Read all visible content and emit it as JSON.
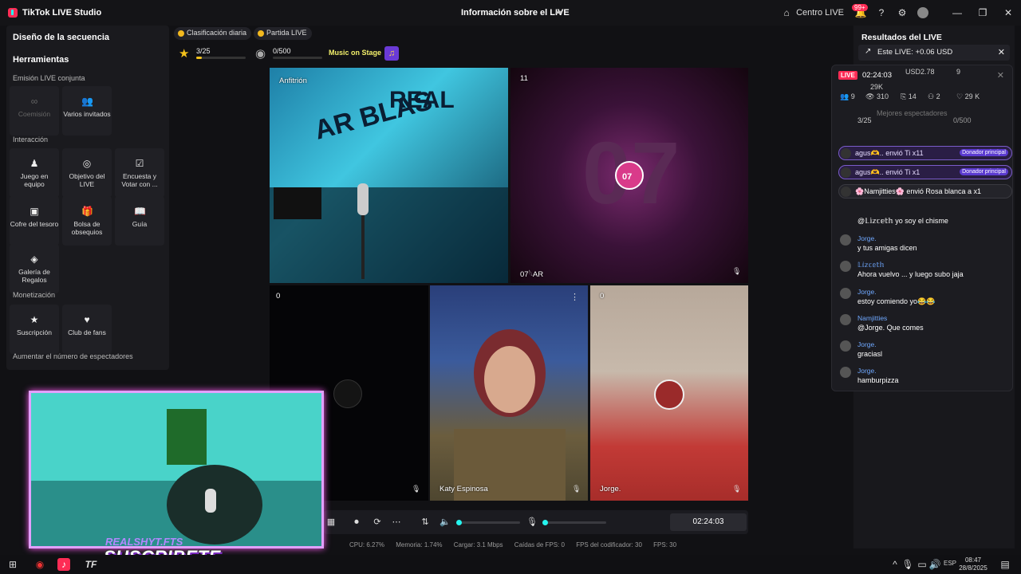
{
  "titlebar": {
    "app_title": "TikTok LIVE Studio",
    "center_title": "Información sobre el LIVE",
    "centro_live": "Centro LIVE",
    "notif_badge": "99+"
  },
  "left": {
    "section_title": "Diseño de la secuencia",
    "tools_title": "Herramientas",
    "emision_label": "Emisión LIVE conjunta",
    "coemision": "Coemisión",
    "varios": "Varios invitados",
    "interaccion_label": "Interacción",
    "juego": "Juego en equipo",
    "objetivo": "Objetivo del LIVE",
    "encuesta": "Encuesta y Votar con ...",
    "cofre": "Cofre del tesoro",
    "bolsa": "Bolsa de obsequios",
    "guia": "Guía",
    "galeria": "Galería de Regalos",
    "monetizacion_label": "Monetización",
    "suscripcion": "Suscripción",
    "club": "Club de fans",
    "aumentar": "Aumentar el número de espectadores"
  },
  "topbar": {
    "clasificacion": "Clasificación diaria",
    "partida": "Partida LIVE",
    "stat1": "3/25",
    "stat1_progress": 0.12,
    "stat2": "0/500",
    "music": "Music on Stage"
  },
  "videos": {
    "host_label": "Anfitrión",
    "tl_count": "11",
    "tl_name": "07𓆩AR",
    "bl_count": "0",
    "bm_name": "Katy Espinosa",
    "br_count": "0",
    "br_name": "Jorge."
  },
  "controls": {
    "timer": "02:24:03",
    "cpu": "CPU: 6.27%",
    "memoria": "Memoria: 1.74%",
    "cargar": "Cargar: 3.1 Mbps",
    "caidas": "Caídas de FPS: 0",
    "fps_cod": "FPS del codificador: 30",
    "fps": "FPS: 30"
  },
  "right": {
    "title": "Resultados del LIVE",
    "este_live": "Este LIVE: +0.06 USD"
  },
  "chat": {
    "live_badge": "LIVE",
    "time": "02:24:03",
    "usd": "USD2.78",
    "likes_top": "29K",
    "viewers": "9",
    "views": "310",
    "gifts": "14",
    "follows": "2",
    "likes": "29 K",
    "mejores": "Mejores espectadores",
    "progress": "3/25",
    "progress2": "0/500",
    "gift1": "agus🫶.. envió Ti x11",
    "gift2": "agus🫶.. envió Ti x1",
    "gift_badge": "Donador principal",
    "gift3": "🌸Namjitties🌸 envió Rosa blanca a x1",
    "m1_name": "@𝕃𝕚𝕫𝕔𝕖𝕥𝕙",
    "m1_text": "@𝕃𝕚𝕫𝕔𝕖𝕥𝕙 yo soy el chisme",
    "m2_name": "Jorge.",
    "m2_text": "y tus amigas dicen",
    "m3_name": "𝕃𝕚𝕫𝕔𝕖𝕥𝕙",
    "m3_text": "Ahora vuelvo ... y luego subo jaja",
    "m4_name": "Jorge.",
    "m4_text": "estoy comiendo yo😂😂",
    "m5_name": "Namjitties",
    "m5_text": "@Jorge. Que comes",
    "m6_name": "Jorge.",
    "m6_text": "graciasl",
    "m7_name": "Jorge.",
    "m7_text": "hamburpizza"
  },
  "taskbar": {
    "lang": "ESP",
    "time": "08:47",
    "date": "28/8/2025"
  },
  "overlay": {
    "suscribete": "SUSCRIBETE",
    "realshyt": "REALSHYT.FTS"
  }
}
